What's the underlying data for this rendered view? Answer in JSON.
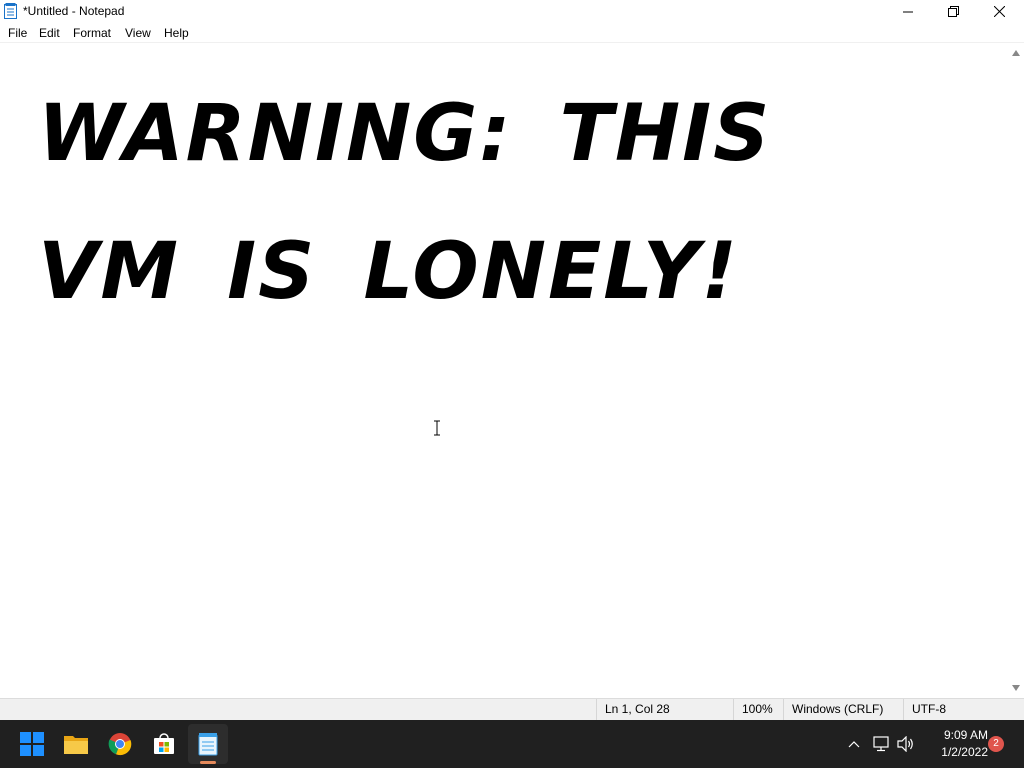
{
  "window": {
    "title": "*Untitled - Notepad",
    "controls": {
      "minimize": "minimize",
      "maximize": "restore",
      "close": "close"
    }
  },
  "menu": {
    "items": [
      "File",
      "Edit",
      "Format",
      "View",
      "Help"
    ]
  },
  "editor": {
    "content": "WARNING: THIS\nVM IS LONELY!"
  },
  "status": {
    "position": "Ln 1, Col 28",
    "zoom": "100%",
    "line_ending": "Windows (CRLF)",
    "encoding": "UTF-8"
  },
  "taskbar": {
    "apps": [
      "start-icon",
      "file-explorer-icon",
      "chrome-icon",
      "store-icon",
      "notepad-icon"
    ],
    "active_app": "notepad-icon",
    "clock_time": "9:09 AM",
    "clock_date": "1/2/2022",
    "notification_count": "2"
  },
  "colors": {
    "taskbar_bg": "#202020",
    "active_indicator": "#e58a5b",
    "badge": "#e0554d",
    "windows_blue": "#1e90ff"
  }
}
